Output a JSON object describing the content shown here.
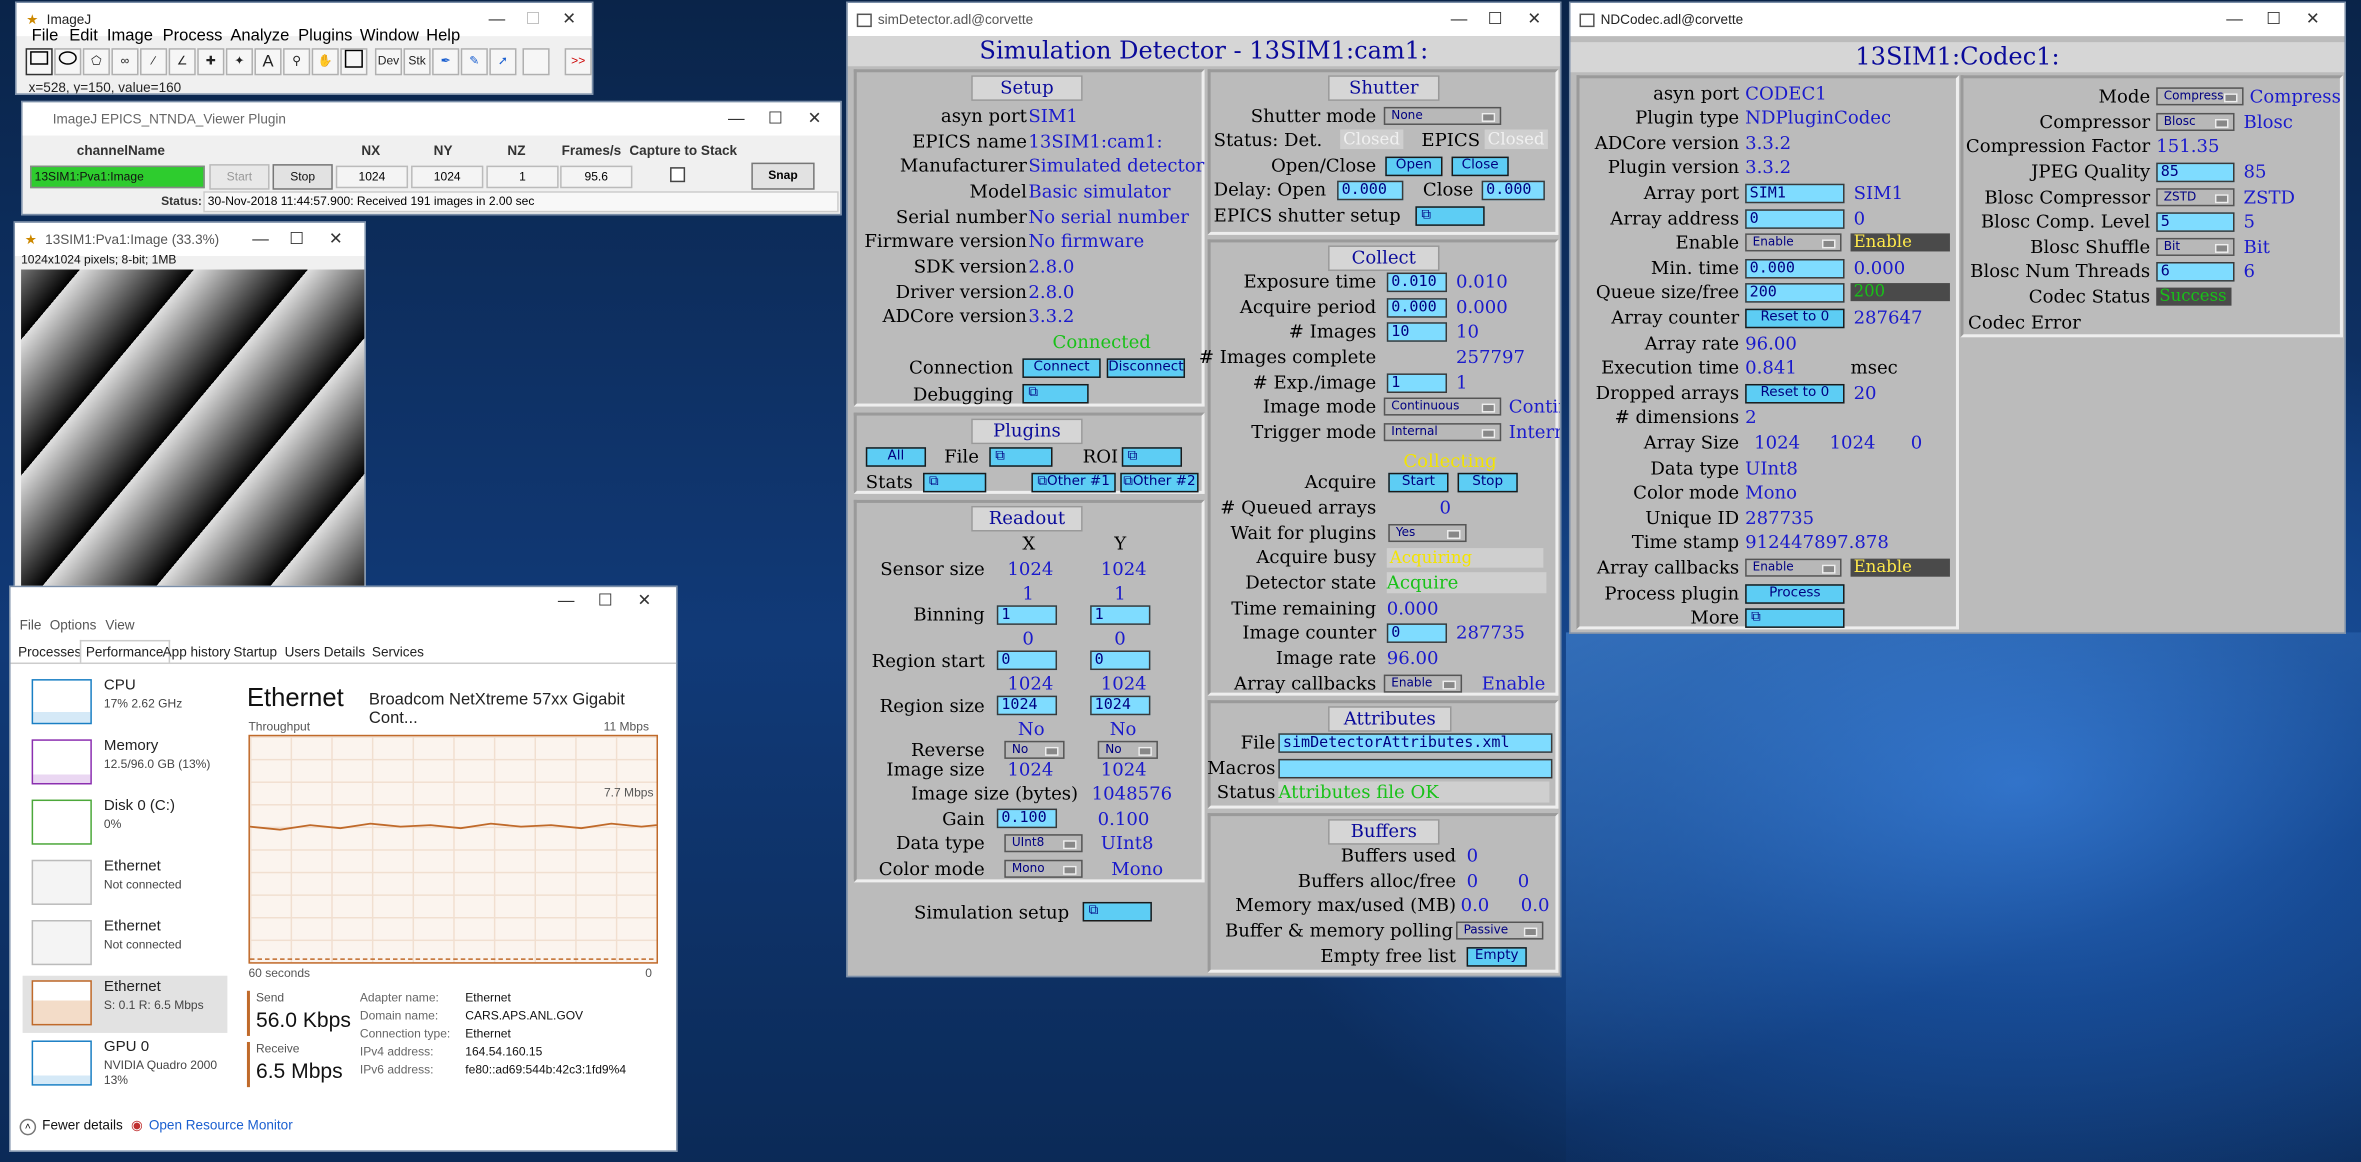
{
  "imagej": {
    "title": "ImageJ",
    "menu": [
      "File",
      "Edit",
      "Image",
      "Process",
      "Analyze",
      "Plugins",
      "Window",
      "Help"
    ],
    "tools": [
      "rect-tool",
      "oval-tool",
      "polygon-tool",
      "freehand-tool",
      "line-tool",
      "angle-tool",
      "point-tool",
      "wand-tool",
      "text-tool",
      "magnifier-tool",
      "hand-tool",
      "color-tool",
      "dev-tool",
      "stk-tool",
      "pen-tool",
      "brush-tool",
      "arrow-tool",
      "more-tools"
    ],
    "tool_labels": {
      "dev": "Dev",
      "stk": "Stk",
      "more": ">>",
      "text": "A"
    },
    "status": "x=528, y=150, value=160"
  },
  "viewer": {
    "title": "ImageJ EPICS_NTNDA_Viewer Plugin",
    "headers": {
      "channel": "channelName",
      "nx": "NX",
      "ny": "NY",
      "nz": "NZ",
      "fps": "Frames/s",
      "capture": "Capture to Stack"
    },
    "channel": "13SIM1:Pva1:Image",
    "start": "Start",
    "stop": "Stop",
    "nx": "1024",
    "ny": "1024",
    "nz": "1",
    "fps": "95.6",
    "snap": "Snap",
    "status_label": "Status:",
    "status": "30-Nov-2018 11:44:57.900: Received 191 images in 2.00 sec"
  },
  "imagewin": {
    "title": "13SIM1:Pva1:Image (33.3%)",
    "info": "1024x1024 pixels; 8-bit; 1MB"
  },
  "taskman": {
    "menu": [
      "File",
      "Options",
      "View"
    ],
    "tabs": [
      "Processes",
      "Performance",
      "App history",
      "Startup",
      "Users",
      "Details",
      "Services"
    ],
    "active_tab": "Performance",
    "side": [
      {
        "name": "CPU",
        "sub": "17% 2.62 GHz",
        "color": "#1a7fc4"
      },
      {
        "name": "Memory",
        "sub": "12.5/96.0 GB (13%)",
        "color": "#8b2fb0"
      },
      {
        "name": "Disk 0 (C:)",
        "sub": "0%",
        "color": "#4ca83a"
      },
      {
        "name": "Ethernet",
        "sub": "Not connected",
        "color": "#aaaaaa"
      },
      {
        "name": "Ethernet",
        "sub": "Not connected",
        "color": "#aaaaaa"
      },
      {
        "name": "Ethernet",
        "sub": "S: 0.1 R: 6.5 Mbps",
        "color": "#c06a2a"
      },
      {
        "name": "GPU 0",
        "sub": "NVIDIA Quadro 2000",
        "sub2": "13%",
        "color": "#1a7fc4"
      }
    ],
    "heading": "Ethernet",
    "adapter": "Broadcom NetXtreme 57xx Gigabit Cont...",
    "throughput": "Throughput",
    "max": "11 Mbps",
    "mark": "7.7 Mbps",
    "seconds": "60 seconds",
    "zero": "0",
    "send_label": "Send",
    "send": "56.0 Kbps",
    "recv_label": "Receive",
    "recv": "6.5 Mbps",
    "details": [
      [
        "Adapter name:",
        "Ethernet"
      ],
      [
        "Domain name:",
        "CARS.APS.ANL.GOV"
      ],
      [
        "Connection type:",
        "Ethernet"
      ],
      [
        "IPv4 address:",
        "164.54.160.15"
      ],
      [
        "IPv6 address:",
        "fe80::ad69:544b:42c3:1fd9%4"
      ]
    ],
    "fewer": "Fewer details",
    "resmon": "Open Resource Monitor"
  },
  "sim": {
    "wintitle": "simDetector.adl@corvette",
    "header": "Simulation Detector - 13SIM1:cam1:",
    "setup": {
      "title": "Setup",
      "asyn_port_l": "asyn port",
      "asyn_port": "SIM1",
      "epics_name_l": "EPICS name",
      "epics_name": "13SIM1:cam1:",
      "manufacturer_l": "Manufacturer",
      "manufacturer": "Simulated detector",
      "model_l": "Model",
      "model": "Basic simulator",
      "serial_l": "Serial number",
      "serial": "No serial number",
      "firmware_l": "Firmware version",
      "firmware": "No firmware",
      "sdk_l": "SDK version",
      "sdk": "2.8.0",
      "driver_l": "Driver version",
      "driver": "2.8.0",
      "adcore_l": "ADCore version",
      "adcore": "3.3.2",
      "connected": "Connected",
      "connection_l": "Connection",
      "connect": "Connect",
      "disconnect": "Disconnect",
      "debugging_l": "Debugging"
    },
    "plugins": {
      "title": "Plugins",
      "all": "All",
      "file_l": "File",
      "roi_l": "ROI",
      "stats_l": "Stats",
      "other1": "Other #1",
      "other2": "Other #2"
    },
    "readout": {
      "title": "Readout",
      "x": "X",
      "y": "Y",
      "sensor_l": "Sensor size",
      "sensor_x": "1024",
      "sensor_y": "1024",
      "binning_rb_x": "1",
      "binning_rb_y": "1",
      "binning_l": "Binning",
      "binning_x": "1",
      "binning_y": "1",
      "start_rb_x": "0",
      "start_rb_y": "0",
      "start_l": "Region start",
      "start_x": "0",
      "start_y": "0",
      "size_rb_x": "1024",
      "size_rb_y": "1024",
      "size_l": "Region size",
      "size_x": "1024",
      "size_y": "1024",
      "rev_rb_x": "No",
      "rev_rb_y": "No",
      "reverse_l": "Reverse",
      "rev_x": "No",
      "rev_y": "No",
      "imgsize_l": "Image size",
      "imgsize_x": "1024",
      "imgsize_y": "1024",
      "bytes_l": "Image size (bytes)",
      "bytes": "1048576",
      "gain_l": "Gain",
      "gain": "0.100",
      "gain_rb": "0.100",
      "dtype_l": "Data type",
      "dtype": "UInt8",
      "dtype_rb": "UInt8",
      "cmode_l": "Color mode",
      "cmode": "Mono",
      "cmode_rb": "Mono"
    },
    "simsetup_l": "Simulation setup",
    "shutter": {
      "title": "Shutter",
      "mode_l": "Shutter mode",
      "mode": "None",
      "status_l": "Status: Det.",
      "det": "Closed",
      "epics_l": "EPICS",
      "epics": "Closed",
      "openclose_l": "Open/Close",
      "open": "Open",
      "close": "Close",
      "delay_l": "Delay: Open",
      "open_delay": "0.000",
      "close_l": "Close",
      "close_delay": "0.000",
      "setup_l": "EPICS shutter setup"
    },
    "collect": {
      "title": "Collect",
      "exp_l": "Exposure time",
      "exp": "0.010",
      "exp_rb": "0.010",
      "period_l": "Acquire period",
      "period": "0.000",
      "period_rb": "0.000",
      "nimg_l": "# Images",
      "nimg": "10",
      "nimg_rb": "10",
      "complete_l": "# Images complete",
      "complete": "257797",
      "nexp_l": "# Exp./image",
      "nexp": "1",
      "nexp_rb": "1",
      "imode_l": "Image mode",
      "imode": "Continuous",
      "imode_rb": "Continuous",
      "trig_l": "Trigger mode",
      "trig": "Internal",
      "trig_rb": "Internal",
      "collecting": "Collecting",
      "acquire_l": "Acquire",
      "start": "Start",
      "stop": "Stop",
      "queued_l": "# Queued arrays",
      "queued": "0",
      "wait_l": "Wait for plugins",
      "wait": "Yes",
      "busy_l": "Acquire busy",
      "busy": "Acquiring",
      "state_l": "Detector state",
      "state": "Acquire",
      "remaining_l": "Time remaining",
      "remaining": "0.000",
      "counter_l": "Image counter",
      "counter": "0",
      "counter_rb": "287735",
      "rate_l": "Image rate",
      "rate": "96.00",
      "callbacks_l": "Array callbacks",
      "callbacks": "Enable",
      "callbacks_rb": "Enable"
    },
    "attributes": {
      "title": "Attributes",
      "file_l": "File",
      "file": "simDetectorAttributes.xml",
      "macros_l": "Macros",
      "macros": "",
      "status_l": "Status",
      "status": "Attributes file OK"
    },
    "buffers": {
      "title": "Buffers",
      "used_l": "Buffers used",
      "used": "0",
      "alloc_l": "Buffers alloc/free",
      "alloc": "0",
      "free": "0",
      "mem_l": "Memory max/used (MB)",
      "mem_max": "0.0",
      "mem_used": "0.0",
      "poll_l": "Buffer & memory polling",
      "poll": "Passive",
      "empty_l": "Empty free list",
      "empty": "Empty"
    }
  },
  "codec": {
    "wintitle": "NDCodec.adl@corvette",
    "header": "13SIM1:Codec1:",
    "left": {
      "asyn_port_l": "asyn port",
      "asyn_port": "CODEC1",
      "ptype_l": "Plugin type",
      "ptype": "NDPluginCodec",
      "adcore_l": "ADCore version",
      "adcore": "3.3.2",
      "pver_l": "Plugin version",
      "pver": "3.3.2",
      "aport_l": "Array port",
      "aport": "SIM1",
      "aport_rb": "SIM1",
      "aaddr_l": "Array address",
      "aaddr": "0",
      "aaddr_rb": "0",
      "enable_l": "Enable",
      "enable": "Enable",
      "enable_rb": "Enable",
      "mintime_l": "Min. time",
      "mintime": "0.000",
      "mintime_rb": "0.000",
      "queue_l": "Queue size/free",
      "queue": "200",
      "queue_rb": "200",
      "counter_l": "Array counter",
      "reset": "Reset to 0",
      "counter": "287647",
      "arate_l": "Array rate",
      "arate": "96.00",
      "exec_l": "Execution time",
      "exec": "0.841",
      "msec": "msec",
      "dropped_l": "Dropped arrays",
      "dropped": "20",
      "ndim_l": "# dimensions",
      "ndim": "2",
      "asize_l": "Array Size",
      "asize0": "1024",
      "asize1": "1024",
      "asize2": "0",
      "dtype_l": "Data type",
      "dtype": "UInt8",
      "cmode_l": "Color mode",
      "cmode": "Mono",
      "uid_l": "Unique ID",
      "uid": "287735",
      "ts_l": "Time stamp",
      "ts": "912447897.878",
      "cb_l": "Array callbacks",
      "cb": "Enable",
      "cb_rb": "Enable",
      "proc_l": "Process plugin",
      "proc": "Process",
      "more_l": "More"
    },
    "right": {
      "mode_l": "Mode",
      "mode": "Compress",
      "mode_rb": "Compress",
      "comp_l": "Compressor",
      "comp": "Blosc",
      "comp_rb": "Blosc",
      "factor_l": "Compression Factor",
      "factor": "151.35",
      "jpeg_l": "JPEG Quality",
      "jpeg": "85",
      "jpeg_rb": "85",
      "bcomp_l": "Blosc Compressor",
      "bcomp": "ZSTD",
      "bcomp_rb": "ZSTD",
      "blevel_l": "Blosc Comp. Level",
      "blevel": "5",
      "blevel_rb": "5",
      "bshuffle_l": "Blosc Shuffle",
      "bshuffle": "Bit",
      "bshuffle_rb": "Bit",
      "bthreads_l": "Blosc Num Threads",
      "bthreads": "6",
      "bthreads_rb": "6",
      "status_l": "Codec Status",
      "status": "Success",
      "error_l": "Codec Error"
    }
  }
}
